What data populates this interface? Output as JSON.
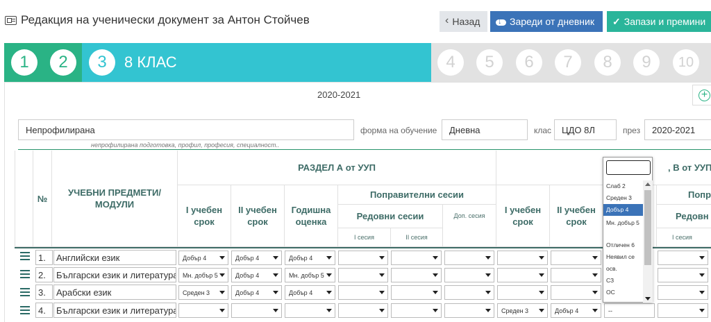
{
  "header": {
    "title": "Редакция на ученически документ за Антон Стойчев",
    "back_label": "Назад",
    "load_label": "Зареди от дневник",
    "save_label": "Запази и премини"
  },
  "steps": {
    "items": [
      "1",
      "2",
      "3",
      "4",
      "5",
      "6",
      "7",
      "8",
      "9",
      "10"
    ],
    "current_label": "8 КЛАС",
    "done_color": "#2ab385",
    "current_color": "#33c4d1",
    "pending_color": "#e2e2e2"
  },
  "panel": {
    "year": "2020-2021"
  },
  "form": {
    "profile_value": "Непрофилирана",
    "profile_hint": "непрофилирана подготовка, профил, професия, специалност..",
    "study_form_label": "форма на обучение",
    "study_form_value": "Дневна",
    "class_label": "клас",
    "class_value": "ЦДО 8Л",
    "year_label": "през",
    "year_value": "2020-2021"
  },
  "table": {
    "col_no": "№",
    "col_subject": "УЧЕБНИ ПРЕДМЕТИ/ МОДУЛИ",
    "section_a": "РАЗДЕЛ А от УУП",
    "section_b": ", В от УУП",
    "term1": "I учебен срок",
    "term2": "II учебен срок",
    "annual": "Годишна оценка",
    "corrective": "Поправителни сесии",
    "corrective_b": "Попр",
    "regular": "Редовни сесии",
    "regular_b": "Редовн",
    "extra": "Доп. сесия",
    "session1": "I сесия",
    "session2": "II сесия",
    "session1_b": "I сесия",
    "term1_b": "I учебен срок",
    "term2_b": "II учебен срок",
    "rows": [
      {
        "no": "1.",
        "subject": "Английски език",
        "t1": "Добър 4",
        "t2": "Добър 4",
        "annual": "Добър 4",
        "b_t1": "",
        "b_t2": ""
      },
      {
        "no": "2.",
        "subject": "Български език и литература",
        "t1": "Мн. добър 5",
        "t2": "Добър 4",
        "annual": "Мн. добър 5",
        "b_t1": "",
        "b_t2": ""
      },
      {
        "no": "3.",
        "subject": "Арабски език",
        "t1": "Среден 3",
        "t2": "Добър 4",
        "annual": "Добър 4",
        "b_t1": "",
        "b_t2": ""
      },
      {
        "no": "4.",
        "subject": "Български език и литература",
        "t1": "",
        "t2": "",
        "annual": "",
        "b_t1": "Среден 3",
        "b_t2": "Добър 4",
        "b_t3": "--"
      }
    ]
  },
  "dropdown": {
    "options": [
      "Слаб 2",
      "Среден 3",
      "Добър 4",
      "Мн. добър 5",
      "Отличен 6",
      "Неявил се",
      "осв.",
      "СЗ",
      "ОС"
    ],
    "selected": "Добър 4"
  }
}
